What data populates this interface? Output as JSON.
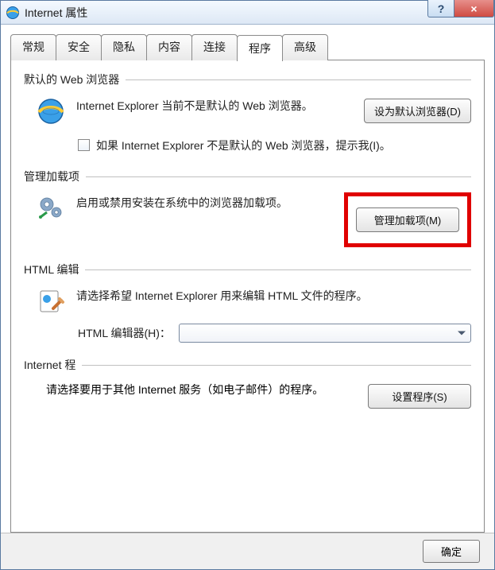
{
  "window": {
    "title": "Internet 属性",
    "help_btn": "?",
    "close_btn": "×"
  },
  "tabs": {
    "t0": "常规",
    "t1": "安全",
    "t2": "隐私",
    "t3": "内容",
    "t4": "连接",
    "t5": "程序",
    "t6": "高级",
    "active_index": 5
  },
  "group_default_browser": {
    "title": "默认的 Web 浏览器",
    "text": "Internet Explorer 当前不是默认的 Web 浏览器。",
    "button": "设为默认浏览器(D)",
    "checkbox_label": "如果 Internet Explorer 不是默认的 Web 浏览器，提示我(I)。"
  },
  "group_addons": {
    "title": "管理加载项",
    "text": "启用或禁用安装在系统中的浏览器加载项。",
    "button": "管理加载项(M)"
  },
  "group_html": {
    "title": "HTML 编辑",
    "text": "请选择希望 Internet Explorer 用来编辑 HTML 文件的程序。",
    "editor_label": "HTML 编辑器(H)：",
    "editor_value": ""
  },
  "group_internet": {
    "title": "Internet 程",
    "text": "请选择要用于其他 Internet 服务（如电子邮件）的程序。",
    "button": "设置程序(S)"
  },
  "bottom": {
    "ok": "确定"
  }
}
